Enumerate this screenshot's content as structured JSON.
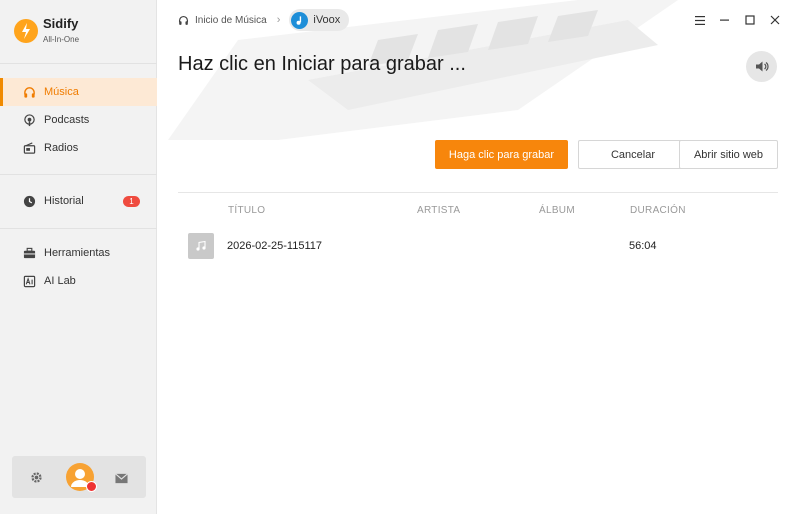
{
  "app": {
    "name": "Sidify",
    "subtitle": "All-In-One"
  },
  "sidebar": {
    "items": [
      {
        "label": "Música",
        "icon": "headphones-icon",
        "active": true
      },
      {
        "label": "Podcasts",
        "icon": "podcast-icon"
      },
      {
        "label": "Radios",
        "icon": "radio-icon"
      },
      {
        "label": "Historial",
        "icon": "clock-icon",
        "badge": "1"
      },
      {
        "label": "Herramientas",
        "icon": "toolbox-icon"
      },
      {
        "label": "AI Lab",
        "icon": "ai-lab-icon"
      }
    ],
    "bottom": {
      "settings_icon": "gear-icon",
      "avatar_icon": "user-avatar-icon",
      "mail_icon": "mail-icon"
    }
  },
  "breadcrumb": {
    "home": "Inicio de Música",
    "current": "iVoox"
  },
  "window_controls": [
    "menu-icon",
    "minimize-icon",
    "maximize-icon",
    "close-icon"
  ],
  "main": {
    "title": "Haz clic en Iniciar para grabar ...",
    "buttons": {
      "record": "Haga clic para grabar",
      "cancel": "Cancelar",
      "open_web": "Abrir sitio web"
    }
  },
  "table": {
    "columns": [
      "TÍTULO",
      "ARTISTA",
      "ÁLBUM",
      "DURACIÓN"
    ],
    "rows": [
      {
        "title": "2026-02-25-115117",
        "artist": "",
        "album": "",
        "duration": "56:04"
      }
    ]
  },
  "colors": {
    "accent": "#f7860c",
    "sidebar_bg": "#f2f2f2",
    "active_bg": "#fde9d5",
    "badge": "#ef4b3f",
    "ivoox": "#1e8ed8"
  }
}
